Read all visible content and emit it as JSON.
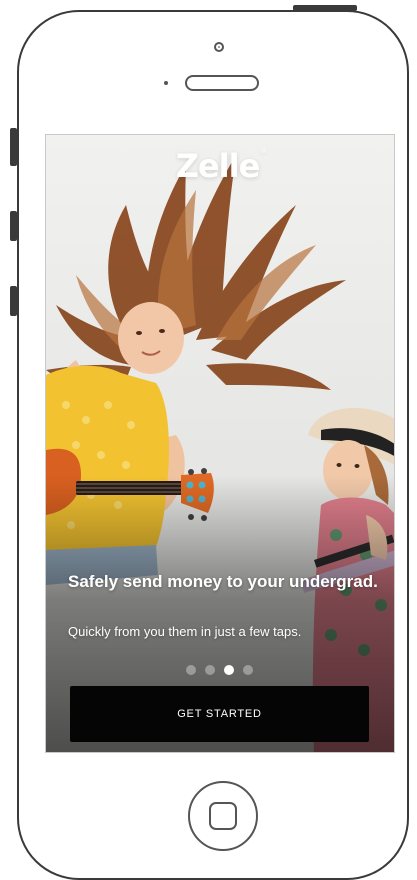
{
  "app": {
    "logo_text": "Zelle",
    "logo_mark": "®"
  },
  "onboarding": {
    "headline": "Safely send money to your undergrad.",
    "subhead": "Quickly from you them in just a few taps.",
    "pager": {
      "total": 4,
      "active_index": 2
    },
    "cta_label": "GET STARTED"
  },
  "colors": {
    "cta_background": "#050505",
    "text": "#ffffff",
    "screen_background": "#efefed"
  }
}
